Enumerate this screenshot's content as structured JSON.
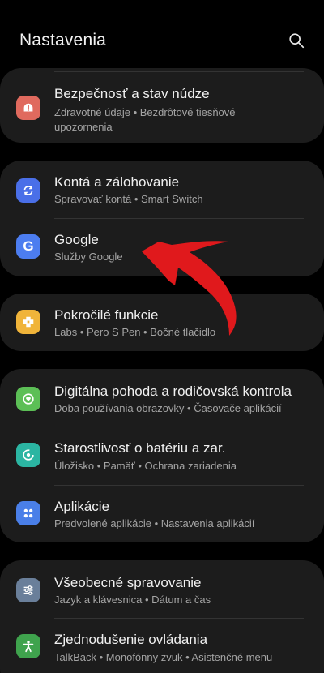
{
  "header": {
    "title": "Nastavenia"
  },
  "items": [
    {
      "title": "Bezpečnosť a stav núdze",
      "subtitle": "Zdravotné údaje  •  Bezdrôtové tiesňové upozornenia",
      "icon": "alert-icon",
      "color": "#e06a5e"
    },
    {
      "title": "Kontá a zálohovanie",
      "subtitle": "Spravovať kontá  •  Smart Switch",
      "icon": "sync-icon",
      "color": "#4a6fe8"
    },
    {
      "title": "Google",
      "subtitle": "Služby Google",
      "icon": "google-icon",
      "color": "#4c7df0"
    },
    {
      "title": "Pokročilé funkcie",
      "subtitle": "Labs  •  Pero S Pen  •  Bočné tlačidlo",
      "icon": "advanced-features-icon",
      "color": "#f0b43a"
    },
    {
      "title": "Digitálna pohoda a rodičovská kontrola",
      "subtitle": "Doba používania obrazovky  •  Časovače aplikácií",
      "icon": "digital-wellbeing-icon",
      "color": "#5cbf56"
    },
    {
      "title": "Starostlivosť o batériu a zar.",
      "subtitle": "Úložisko  •  Pamäť  •  Ochrana zariadenia",
      "icon": "device-care-icon",
      "color": "#2bb5a2"
    },
    {
      "title": "Aplikácie",
      "subtitle": "Predvolené aplikácie  •  Nastavenia aplikácií",
      "icon": "apps-icon",
      "color": "#4a7fe8"
    },
    {
      "title": "Všeobecné spravovanie",
      "subtitle": "Jazyk a klávesnica  •  Dátum a čas",
      "icon": "sliders-icon",
      "color": "#6a7f9a"
    },
    {
      "title": "Zjednodušenie ovládania",
      "subtitle": "TalkBack  •  Monofónny zvuk  •  Asistenčné menu",
      "icon": "accessibility-icon",
      "color": "#3fa34d"
    }
  ],
  "annotation": {
    "arrow_color": "#e0191c"
  }
}
